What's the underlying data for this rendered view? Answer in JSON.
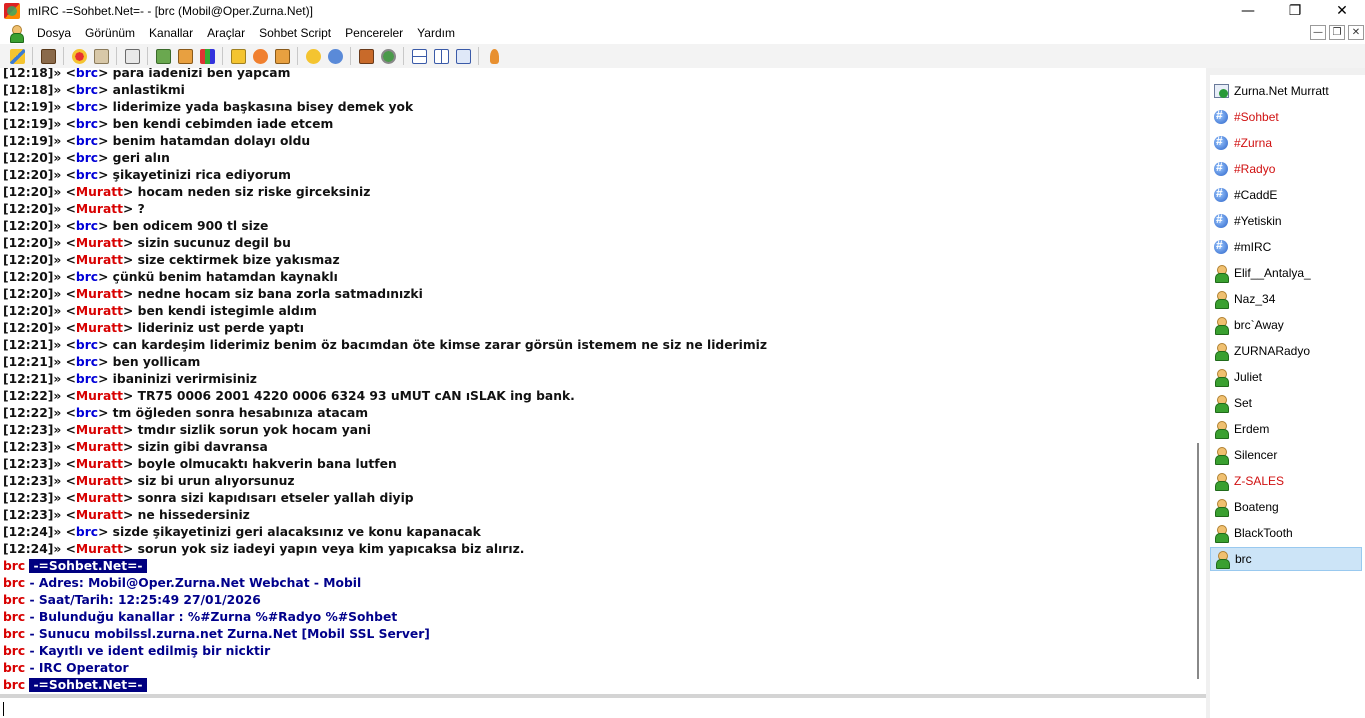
{
  "window": {
    "title": "mIRC -=Sohbet.Net=- - [brc (Mobil@Oper.Zurna.Net)]"
  },
  "menu": [
    "Dosya",
    "Görünüm",
    "Kanallar",
    "Araçlar",
    "Sohbet Script",
    "Pencereler",
    "Yardım"
  ],
  "colors": {
    "brc": "#0000d8",
    "muratt": "#d80000",
    "whois": "#00008b",
    "highlight_bg": "#000080",
    "channel_red": "#d01010"
  },
  "chat": [
    {
      "time": "[12:18]",
      "nick": "brc",
      "text": "para iadenizi ben yapcam"
    },
    {
      "time": "[12:18]",
      "nick": "brc",
      "text": "anlastikmi"
    },
    {
      "time": "[12:19]",
      "nick": "brc",
      "text": "liderimize yada başkasına bisey demek yok"
    },
    {
      "time": "[12:19]",
      "nick": "brc",
      "text": "ben kendi cebimden iade etcem"
    },
    {
      "time": "[12:19]",
      "nick": "brc",
      "text": "benim hatamdan dolayı oldu"
    },
    {
      "time": "[12:20]",
      "nick": "brc",
      "text": "geri alın"
    },
    {
      "time": "[12:20]",
      "nick": "brc",
      "text": "şikayetinizi rica ediyorum"
    },
    {
      "time": "[12:20]",
      "nick": "Muratt",
      "text": "hocam neden siz riske girceksiniz"
    },
    {
      "time": "[12:20]",
      "nick": "Muratt",
      "text": "?"
    },
    {
      "time": "[12:20]",
      "nick": "brc",
      "text": "ben odicem 900 tl size"
    },
    {
      "time": "[12:20]",
      "nick": "Muratt",
      "text": "sizin sucunuz degil bu"
    },
    {
      "time": "[12:20]",
      "nick": "Muratt",
      "text": "size cektirmek bize yakısmaz"
    },
    {
      "time": "[12:20]",
      "nick": "brc",
      "text": "çünkü benim hatamdan kaynaklı"
    },
    {
      "time": "[12:20]",
      "nick": "Muratt",
      "text": "nedne hocam siz bana zorla satmadınızki"
    },
    {
      "time": "[12:20]",
      "nick": "Muratt",
      "text": "ben kendi istegimle aldım"
    },
    {
      "time": "[12:20]",
      "nick": "Muratt",
      "text": "lideriniz ust perde yaptı"
    },
    {
      "time": "[12:21]",
      "nick": "brc",
      "text": "can kardeşim liderimiz benim öz bacımdan öte kimse zarar görsün istemem ne siz ne liderimiz"
    },
    {
      "time": "[12:21]",
      "nick": "brc",
      "text": "ben yollicam"
    },
    {
      "time": "[12:21]",
      "nick": "brc",
      "text": "ibaninizi verirmisiniz"
    },
    {
      "time": "[12:22]",
      "nick": "Muratt",
      "text": "TR75 0006 2001 4220 0006 6324 93 uMUT cAN ıSLAK ing bank."
    },
    {
      "time": "[12:22]",
      "nick": "brc",
      "text": "tm öğleden sonra hesabınıza atacam"
    },
    {
      "time": "[12:23]",
      "nick": "Muratt",
      "text": "tmdır sizlik sorun yok hocam yani"
    },
    {
      "time": "[12:23]",
      "nick": "Muratt",
      "text": "sizin gibi davransa"
    },
    {
      "time": "[12:23]",
      "nick": "Muratt",
      "text": "boyle olmucaktı hakverin bana lutfen"
    },
    {
      "time": "[12:23]",
      "nick": "Muratt",
      "text": "siz bi urun alıyorsunuz"
    },
    {
      "time": "[12:23]",
      "nick": "Muratt",
      "text": "sonra sizi kapıdısarı etseler yallah diyip"
    },
    {
      "time": "[12:23]",
      "nick": "Muratt",
      "text": "ne hissedersiniz"
    },
    {
      "time": "[12:24]",
      "nick": "brc",
      "text": "sizde şikayetinizi geri alacaksınız ve konu kapanacak"
    },
    {
      "time": "[12:24]",
      "nick": "Muratt",
      "text": "sorun yok siz iadeyi yapın veya kim yapıcaksa biz alırız."
    }
  ],
  "whois": {
    "nick": "brc",
    "banner": "-=Sohbet.Net=-",
    "lines": [
      "- Adres: Mobil@Oper.Zurna.Net Webchat - Mobil",
      "- Saat/Tarih: 12:25:49 27/01/2026",
      "- Bulunduğu kanallar : %#Zurna %#Radyo %#Sohbet",
      "- Sunucu mobilssl.zurna.net Zurna.Net [Mobil SSL Server]",
      "- Kayıtlı ve ident edilmiş bir nicktir",
      "- IRC Operator"
    ]
  },
  "treebar": [
    {
      "label": "Zurna.Net Murratt",
      "icon": "status-window-icon",
      "color": "#000000"
    },
    {
      "label": "#Sohbet",
      "icon": "channel-icon",
      "color": "#d01010"
    },
    {
      "label": "#Zurna",
      "icon": "channel-icon",
      "color": "#d01010"
    },
    {
      "label": "#Radyo",
      "icon": "channel-icon",
      "color": "#d01010"
    },
    {
      "label": "#CaddE",
      "icon": "channel-icon",
      "color": "#000000"
    },
    {
      "label": "#Yetiskin",
      "icon": "channel-icon",
      "color": "#000000"
    },
    {
      "label": "#mIRC",
      "icon": "channel-icon",
      "color": "#000000"
    },
    {
      "label": "Elif__Antalya_",
      "icon": "user-icon",
      "color": "#000000"
    },
    {
      "label": "Naz_34",
      "icon": "user-icon",
      "color": "#000000"
    },
    {
      "label": "brc`Away",
      "icon": "user-icon",
      "color": "#000000"
    },
    {
      "label": "ZURNARadyo",
      "icon": "user-icon",
      "color": "#000000"
    },
    {
      "label": "Juliet",
      "icon": "user-icon",
      "color": "#000000"
    },
    {
      "label": "Set",
      "icon": "user-icon",
      "color": "#000000"
    },
    {
      "label": "Erdem",
      "icon": "user-icon",
      "color": "#000000"
    },
    {
      "label": "Silencer",
      "icon": "user-icon",
      "color": "#000000"
    },
    {
      "label": "Z-SALES",
      "icon": "user-icon",
      "color": "#d01010"
    },
    {
      "label": "Boateng",
      "icon": "user-icon",
      "color": "#000000"
    },
    {
      "label": "BlackTooth",
      "icon": "user-icon",
      "color": "#000000"
    },
    {
      "label": "brc",
      "icon": "user-icon",
      "color": "#000000",
      "selected": true
    }
  ],
  "input": {
    "value": ""
  }
}
